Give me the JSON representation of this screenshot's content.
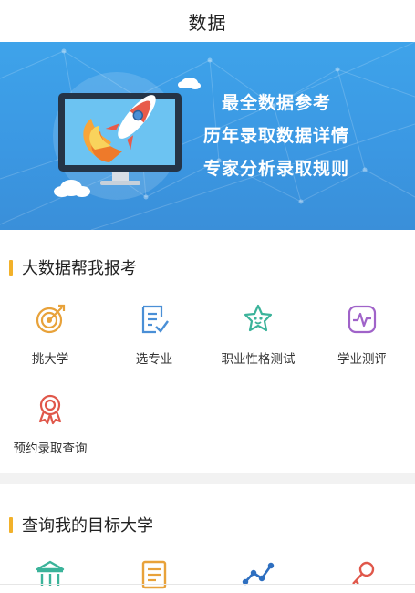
{
  "header": {
    "title": "数据"
  },
  "banner": {
    "line1": "最全数据参考",
    "line2": "历年录取数据详情",
    "line3": "专家分析录取规则",
    "illustration": "rocket-launch-from-monitor"
  },
  "section1": {
    "title": "大数据帮我报考",
    "items": [
      {
        "label": "挑大学",
        "icon": "target-icon"
      },
      {
        "label": "选专业",
        "icon": "checklist-icon"
      },
      {
        "label": "职业性格测试",
        "icon": "personality-icon"
      },
      {
        "label": "学业测评",
        "icon": "pulse-icon"
      },
      {
        "label": "预约录取查询",
        "icon": "award-badge-icon"
      }
    ]
  },
  "section2": {
    "title": "查询我的目标大学",
    "items": [
      {
        "icon": "university-icon"
      },
      {
        "icon": "document-icon"
      },
      {
        "icon": "trend-line-icon"
      },
      {
        "icon": "key-icon"
      }
    ]
  },
  "colors": {
    "accent": "#f2b12a",
    "banner": "#3b98e3",
    "icon_orange": "#e8a23a",
    "icon_blue": "#4a8fd6",
    "icon_teal": "#3bb39a",
    "icon_purple": "#a063c9",
    "icon_red": "#e0574a"
  }
}
